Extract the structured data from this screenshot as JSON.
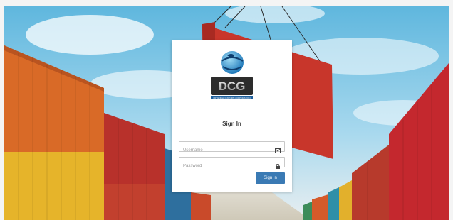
{
  "login": {
    "title": "Sign In",
    "username_placeholder": "Username",
    "password_placeholder": "Password",
    "submit_label": "Sign In",
    "button_color": "#3a7ab4"
  },
  "logo": {
    "monogram": "DCG",
    "tagline": "DP WORLD EXPORT CORPORATION"
  },
  "icons": {
    "username": "envelope-icon",
    "password": "lock-icon"
  }
}
